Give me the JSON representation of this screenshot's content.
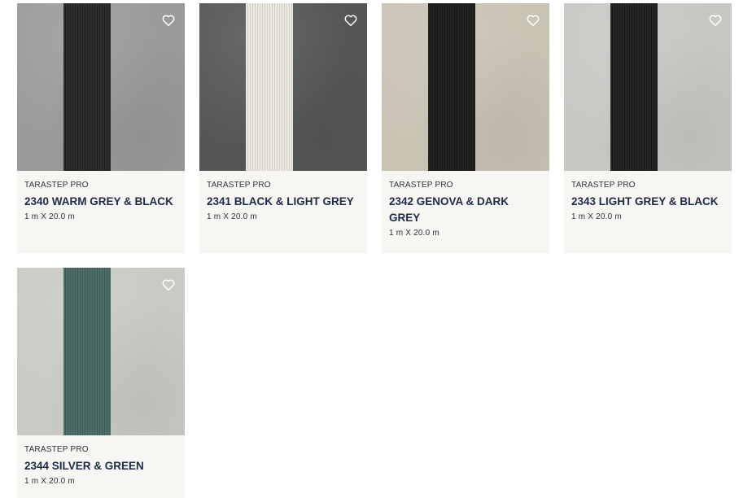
{
  "products": [
    {
      "brand": "TARASTEP PRO",
      "title": "2340 WARM GREY & BLACK",
      "size": "1 m X 20.0 m",
      "colors": {
        "base": "#9a9b98",
        "strip": "#2e302f",
        "rib": "#1f2120"
      },
      "favorite_icon": "heart-outline-icon"
    },
    {
      "brand": "TARASTEP PRO",
      "title": "2341 BLACK & LIGHT GREY",
      "size": "1 m X 20.0 m",
      "colors": {
        "base": "#555658",
        "strip": "#e9e7e0",
        "rib": "#d2cfc6"
      },
      "favorite_icon": "heart-outline-icon"
    },
    {
      "brand": "TARASTEP PRO",
      "title": "2342 GENOVA & DARK GREY",
      "size": "1 m X 20.0 m",
      "colors": {
        "base": "#c9c3b4",
        "strip": "#232422",
        "rib": "#151615"
      },
      "favorite_icon": "heart-outline-icon"
    },
    {
      "brand": "TARASTEP PRO",
      "title": "2343 LIGHT GREY & BLACK",
      "size": "1 m X 20.0 m",
      "colors": {
        "base": "#c6c8c4",
        "strip": "#262827",
        "rib": "#171918"
      },
      "favorite_icon": "heart-outline-icon"
    },
    {
      "brand": "TARASTEP PRO",
      "title": "2344 SILVER & GREEN",
      "size": "1 m X 20.0 m",
      "colors": {
        "base": "#c8cac4",
        "strip": "#4d6e69",
        "rib": "#3e5c58"
      },
      "favorite_icon": "heart-outline-icon"
    }
  ]
}
